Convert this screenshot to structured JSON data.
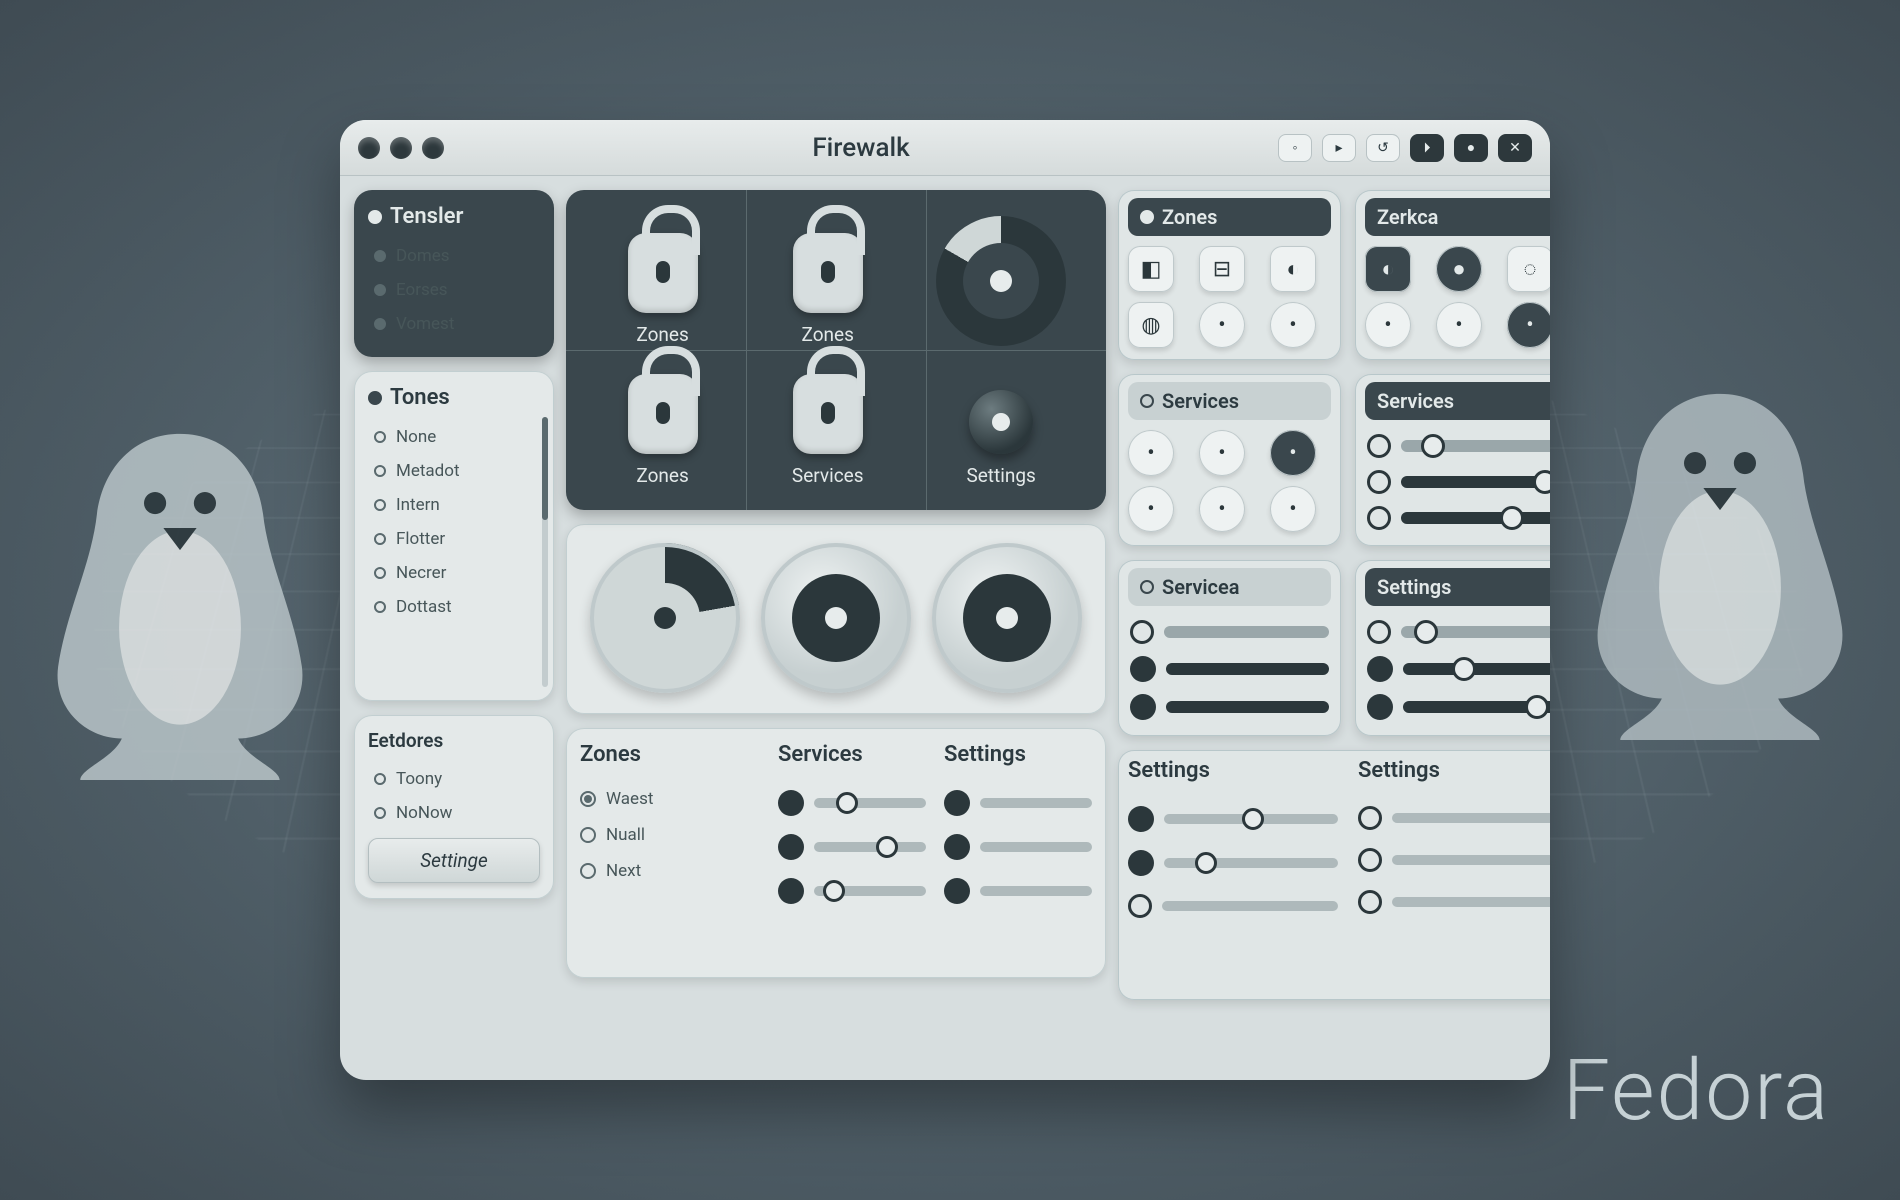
{
  "brand": "Fedora",
  "titlebar": {
    "title": "Firewalk",
    "buttons": [
      "◦",
      "▸",
      "↺",
      "⏵",
      "●",
      "✕"
    ]
  },
  "sidebar": {
    "group1": {
      "title": "Tensler",
      "items": [
        "Domes",
        "Eorses",
        "Vomest"
      ]
    },
    "group2": {
      "title": "Tones",
      "items": [
        "None",
        "Metadot",
        "Intern",
        "Flotter",
        "Necrer",
        "Dottast"
      ]
    },
    "group3": {
      "title": "Eetdores",
      "items": [
        "Toony",
        "NoNow"
      ],
      "button": "Settinge"
    }
  },
  "main": {
    "grid": {
      "cells": [
        {
          "label": "Zones",
          "icon": "lock"
        },
        {
          "label": "Zones",
          "icon": "lock"
        },
        {
          "label": "",
          "icon": "donut"
        },
        {
          "label": "Zones",
          "icon": "lock"
        },
        {
          "label": "Services",
          "icon": "lock"
        },
        {
          "label": "Settings",
          "icon": "knob"
        }
      ]
    },
    "bottom": {
      "cols": [
        "Zones",
        "Services",
        "Settings"
      ],
      "zones": [
        "Waest",
        "Nuall",
        "Next"
      ]
    }
  },
  "right": {
    "panels": [
      {
        "title": "Zones",
        "variant": "icons"
      },
      {
        "title": "Zerkca",
        "variant": "icons-dark"
      },
      {
        "title": "Services",
        "variant": "dots"
      },
      {
        "title": "Services",
        "variant": "sliders"
      },
      {
        "title": "Servicea",
        "variant": "sliders-lt"
      },
      {
        "title": "Settings",
        "variant": "sliders"
      }
    ],
    "wide": {
      "cols": [
        "Settings",
        "Settings"
      ]
    }
  }
}
